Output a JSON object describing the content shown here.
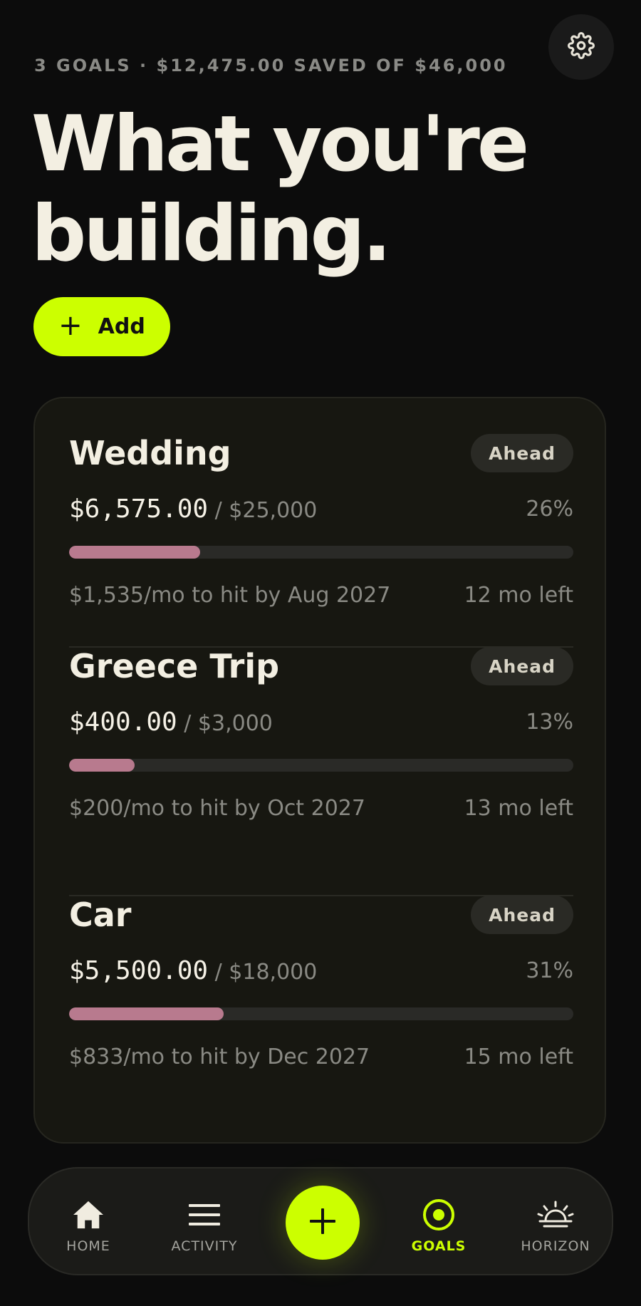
{
  "header": {
    "summary": "3 GOALS · $12,475.00 SAVED OF $46,000",
    "title_line1": "What you're",
    "title_line2": "building.",
    "add_label": "Add"
  },
  "goals": [
    {
      "name": "Wedding",
      "status": "Ahead",
      "saved": "$6,575.00",
      "target": "$25,000",
      "percent": "26%",
      "progress": 0.26,
      "plan": "$1,535/mo to hit by Aug 2027",
      "time_left": "12 mo left"
    },
    {
      "name": "Greece Trip",
      "status": "Ahead",
      "saved": "$400.00",
      "target": "$3,000",
      "percent": "13%",
      "progress": 0.13,
      "plan": "$200/mo to hit by Oct 2027",
      "time_left": "13 mo left"
    },
    {
      "name": "Car",
      "status": "Ahead",
      "saved": "$5,500.00",
      "target": "$18,000",
      "percent": "31%",
      "progress": 0.306,
      "plan": "$833/mo to hit by Dec 2027",
      "time_left": "15 mo left"
    }
  ],
  "nav": {
    "home": "HOME",
    "activity": "ACTIVITY",
    "goals": "GOALS",
    "horizon": "HORIZON",
    "active": "goals"
  },
  "colors": {
    "accent": "#ccff00",
    "progress": "#b87a8e",
    "background": "#0c0c0c",
    "card": "#171711"
  },
  "icons": {
    "settings": "gear-icon",
    "add": "plus-icon",
    "home": "home-icon",
    "activity": "menu-lines-icon",
    "fab": "plus-icon",
    "goals": "target-icon",
    "horizon": "sunrise-icon"
  }
}
